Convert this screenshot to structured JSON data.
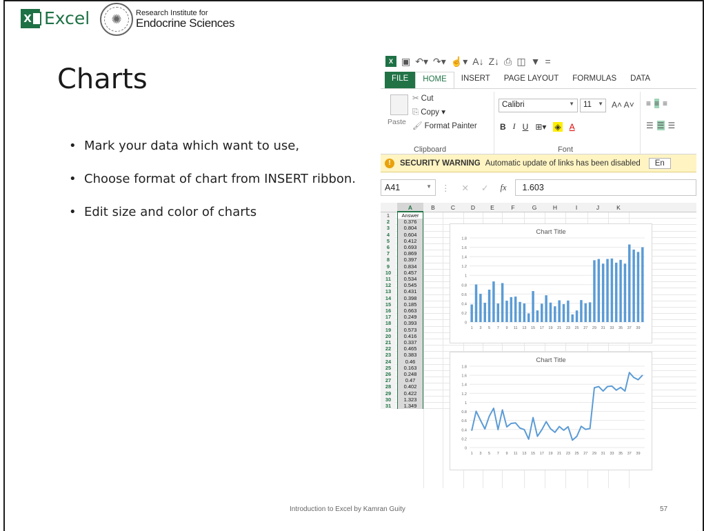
{
  "slide": {
    "title": "Charts",
    "bullets": [
      "Mark your data which want to use,",
      "Choose format of chart from INSERT ribbon.",
      "Edit size and color of charts"
    ],
    "footer_text": "Introduction to Excel by Kamran Guity",
    "page_number": "57"
  },
  "header": {
    "excel_logo_letter": "X",
    "excel_logo_text": "Excel",
    "institute_line1": "Research Institute for",
    "institute_line2": "Endocrine Sciences"
  },
  "excel": {
    "tabs": [
      "FILE",
      "HOME",
      "INSERT",
      "PAGE LAYOUT",
      "FORMULAS",
      "DATA"
    ],
    "active_tab": "HOME",
    "clipboard": {
      "paste_label": "Paste",
      "cut_label": "Cut",
      "copy_label": "Copy",
      "format_painter_label": "Format Painter",
      "group_label": "Clipboard"
    },
    "font": {
      "font_name": "Calibri",
      "font_size": "11",
      "group_label": "Font"
    },
    "security": {
      "title": "SECURITY WARNING",
      "message": "Automatic update of links has been disabled",
      "button_label": "En"
    },
    "formula_bar": {
      "name_box": "A41",
      "value": "1.603"
    },
    "columns": [
      "A",
      "B",
      "C",
      "D",
      "E",
      "F",
      "G",
      "H",
      "I",
      "J",
      "K"
    ],
    "rows": [
      {
        "n": "1",
        "a": "Answer"
      },
      {
        "n": "2",
        "a": "0.376"
      },
      {
        "n": "3",
        "a": "0.804"
      },
      {
        "n": "4",
        "a": "0.604"
      },
      {
        "n": "5",
        "a": "0.412"
      },
      {
        "n": "6",
        "a": "0.693"
      },
      {
        "n": "7",
        "a": "0.869"
      },
      {
        "n": "8",
        "a": "0.397"
      },
      {
        "n": "9",
        "a": "0.834"
      },
      {
        "n": "10",
        "a": "0.457"
      },
      {
        "n": "11",
        "a": "0.534"
      },
      {
        "n": "12",
        "a": "0.545"
      },
      {
        "n": "13",
        "a": "0.431"
      },
      {
        "n": "14",
        "a": "0.398"
      },
      {
        "n": "15",
        "a": "0.185"
      },
      {
        "n": "16",
        "a": "0.663"
      },
      {
        "n": "17",
        "a": "0.249"
      },
      {
        "n": "18",
        "a": "0.393"
      },
      {
        "n": "19",
        "a": "0.573"
      },
      {
        "n": "20",
        "a": "0.416"
      },
      {
        "n": "21",
        "a": "0.337"
      },
      {
        "n": "22",
        "a": "0.465"
      },
      {
        "n": "23",
        "a": "0.383"
      },
      {
        "n": "24",
        "a": "0.46"
      },
      {
        "n": "25",
        "a": "0.163"
      },
      {
        "n": "26",
        "a": "0.248"
      },
      {
        "n": "27",
        "a": "0.47"
      },
      {
        "n": "28",
        "a": "0.402"
      },
      {
        "n": "29",
        "a": "0.422"
      },
      {
        "n": "30",
        "a": "1.323"
      },
      {
        "n": "31",
        "a": "1.349"
      }
    ]
  },
  "chart_data": [
    {
      "type": "bar",
      "title": "Chart Title",
      "ylim": [
        0,
        1.8
      ],
      "yticks": [
        "0",
        "0.2",
        "0.4",
        "0.6",
        "0.8",
        "1",
        "1.2",
        "1.4",
        "1.6",
        "1.8"
      ],
      "xtick_labels": [
        "1",
        "3",
        "5",
        "7",
        "9",
        "11",
        "13",
        "15",
        "17",
        "19",
        "21",
        "23",
        "25",
        "27",
        "29",
        "31",
        "33",
        "35",
        "37",
        "39"
      ],
      "color": "#5b9bd5",
      "values": [
        0.376,
        0.804,
        0.604,
        0.412,
        0.693,
        0.869,
        0.397,
        0.834,
        0.457,
        0.534,
        0.545,
        0.431,
        0.398,
        0.185,
        0.663,
        0.249,
        0.393,
        0.573,
        0.416,
        0.337,
        0.465,
        0.383,
        0.46,
        0.163,
        0.248,
        0.47,
        0.402,
        0.422,
        1.323,
        1.349,
        1.25,
        1.35,
        1.36,
        1.27,
        1.33,
        1.25,
        1.66,
        1.55,
        1.5,
        1.6
      ]
    },
    {
      "type": "line",
      "title": "Chart Title",
      "ylim": [
        0,
        1.8
      ],
      "yticks": [
        "0",
        "0.2",
        "0.4",
        "0.6",
        "0.8",
        "1",
        "1.2",
        "1.4",
        "1.6",
        "1.8"
      ],
      "xtick_labels": [
        "1",
        "3",
        "5",
        "7",
        "9",
        "11",
        "13",
        "15",
        "17",
        "19",
        "21",
        "23",
        "25",
        "27",
        "29",
        "31",
        "33",
        "35",
        "37",
        "39"
      ],
      "color": "#5b9bd5",
      "values": [
        0.376,
        0.804,
        0.604,
        0.412,
        0.693,
        0.869,
        0.397,
        0.834,
        0.457,
        0.534,
        0.545,
        0.431,
        0.398,
        0.185,
        0.663,
        0.249,
        0.393,
        0.573,
        0.416,
        0.337,
        0.465,
        0.383,
        0.46,
        0.163,
        0.248,
        0.47,
        0.402,
        0.422,
        1.323,
        1.349,
        1.25,
        1.35,
        1.36,
        1.27,
        1.33,
        1.25,
        1.66,
        1.55,
        1.5,
        1.6
      ]
    }
  ]
}
